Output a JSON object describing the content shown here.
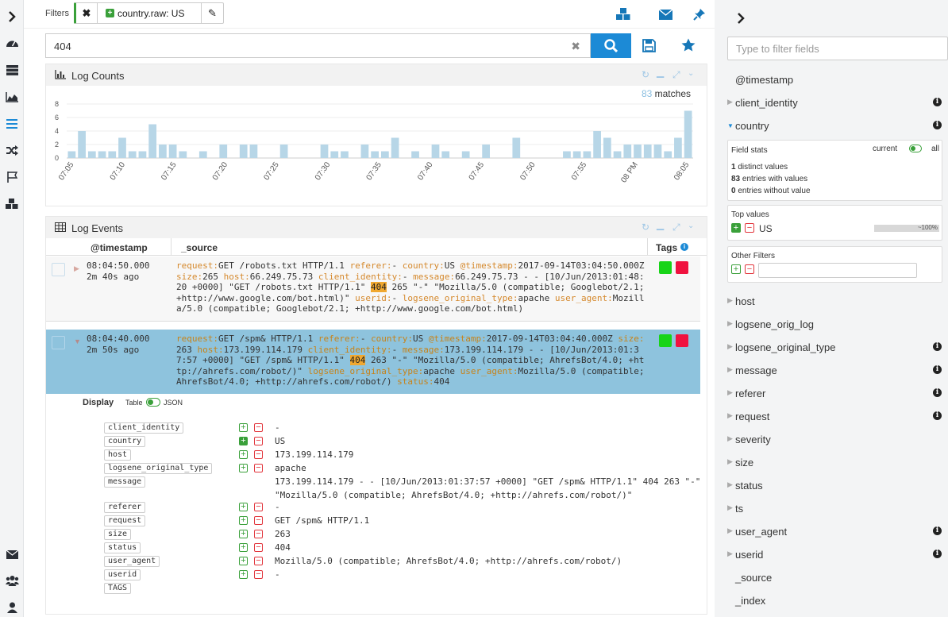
{
  "sidebar": {
    "icons": [
      "chevron-right-icon",
      "dashboard-icon",
      "server-icon",
      "area-chart-icon",
      "list-icon",
      "shuffle-icon",
      "flag-icon",
      "cubes-icon",
      "envelope-icon",
      "users-icon",
      "user-icon"
    ]
  },
  "filters": {
    "label": "Filters",
    "chip": "country.raw: US"
  },
  "search": {
    "query": "404"
  },
  "log_counts": {
    "title": "Log Counts",
    "match_count": "83",
    "match_label": "matches",
    "chart_data": {
      "type": "bar",
      "x_ticks": [
        "07:05",
        "07:10",
        "07:15",
        "07:20",
        "07:25",
        "07:30",
        "07:35",
        "07:40",
        "07:45",
        "07:50",
        "07:55",
        "08 PM",
        "08:05"
      ],
      "y_ticks": [
        "8",
        "6",
        "4",
        "2",
        "0"
      ],
      "ylim": [
        0,
        8
      ],
      "values": [
        1,
        4,
        1,
        1,
        1,
        3,
        1,
        1,
        5,
        2,
        2,
        1,
        0,
        1,
        0,
        2,
        0,
        2,
        2,
        0,
        0,
        2,
        0,
        0,
        0,
        2,
        1,
        1,
        0,
        2,
        1,
        1,
        3,
        0,
        1,
        0,
        2,
        1,
        0,
        1,
        0,
        2,
        0,
        0,
        3,
        0,
        0,
        0,
        0,
        1,
        1,
        1,
        4,
        3,
        1,
        2,
        2,
        2,
        2,
        1,
        3,
        7
      ]
    }
  },
  "log_events": {
    "title": "Log Events",
    "col_timestamp": "@timestamp",
    "col_source": "_source",
    "col_tags": "Tags",
    "rows": [
      {
        "time": "08:04:50.000",
        "ago": "2m 40s ago",
        "k_request": "request:",
        "v_request": "GET /robots.txt HTTP/1.1",
        "k_referer": "referer:",
        "v_referer": "-",
        "k_country": "country:",
        "v_country": "US",
        "k_ts": "@timestamp:",
        "v_ts": "2017-09-14T03:04:50.000Z",
        "k_size": "size:",
        "v_size": "265",
        "k_host": "host:",
        "v_host": "66.249.75.73",
        "k_client": "client_identity:",
        "v_client": "-",
        "k_message": "message:",
        "v_message_a": "66.249.75.73 - - [10/Jun/2013:01:48:20 +0000] \"GET /robots.txt HTTP/1.1\"",
        "v_message_hl": "404",
        "v_message_b": "265 \"-\" \"Mozilla/5.0 (compatible; Googlebot/2.1; +http://www.google.com/bot.html)\"",
        "k_userid": "userid:",
        "v_userid": "-",
        "k_lot": "logsene_original_type:",
        "v_lot": "apache",
        "k_ua": "user_agent:",
        "v_ua": "Mozilla/5.0 (compatible; Googlebot/2.1; +http://www.google.com/bot.html)"
      },
      {
        "time": "08:04:40.000",
        "ago": "2m 50s ago",
        "k_request": "request:",
        "v_request": "GET /spm& HTTP/1.1",
        "k_referer": "referer:",
        "v_referer": "-",
        "k_country": "country:",
        "v_country": "US",
        "k_ts": "@timestamp:",
        "v_ts": "2017-09-14T03:04:40.000Z",
        "k_size": "size:",
        "v_size": "263",
        "k_host": "host:",
        "v_host": "173.199.114.179",
        "k_client": "client_identity:",
        "v_client": "-",
        "k_message": "message:",
        "v_message_a": "173.199.114.179 - - [10/Jun/2013:01:37:57 +0000] \"GET /spm& HTTP/1.1\"",
        "v_message_hl": "404",
        "v_message_b": "263 \"-\" \"Mozilla/5.0 (compatible; AhrefsBot/4.0; +http://ahrefs.com/robot/)\"",
        "k_lot": "logsene_original_type:",
        "v_lot": "apache",
        "k_ua": "user_agent:",
        "v_ua": "Mozilla/5.0 (compatible; AhrefsBot/4.0; +http://ahrefs.com/robot/)",
        "k_status": "status:",
        "v_status": "404"
      }
    ],
    "detail": {
      "display_label": "Display",
      "table_label": "Table",
      "json_label": "JSON",
      "fields": [
        {
          "name": "client_identity",
          "value": "-"
        },
        {
          "name": "country",
          "value": "US"
        },
        {
          "name": "host",
          "value": "173.199.114.179"
        },
        {
          "name": "logsene_original_type",
          "value": "apache"
        },
        {
          "name": "message",
          "value": "173.199.114.179 - - [10/Jun/2013:01:37:57 +0000] \"GET /spm& HTTP/1.1\" 404 263 \"-\" \"Mozilla/5.0 (compatible; AhrefsBot/4.0; +http://ahrefs.com/robot/)\""
        },
        {
          "name": "referer",
          "value": "-"
        },
        {
          "name": "request",
          "value": "GET /spm& HTTP/1.1"
        },
        {
          "name": "size",
          "value": "263"
        },
        {
          "name": "status",
          "value": "404"
        },
        {
          "name": "user_agent",
          "value": "Mozilla/5.0 (compatible; AhrefsBot/4.0; +http://ahrefs.com/robot/)"
        },
        {
          "name": "userid",
          "value": "-"
        },
        {
          "name": "TAGS",
          "value": ""
        }
      ]
    }
  },
  "fields_panel": {
    "filter_placeholder": "Type to filter fields",
    "timestamp_field": "@timestamp",
    "fields_top": [
      {
        "name": "client_identity",
        "info": true
      },
      {
        "name": "country",
        "info": true,
        "expanded": true
      }
    ],
    "field_stats": {
      "title": "Field stats",
      "current": "current",
      "all": "all",
      "distinct_n": "1",
      "distinct_text": "distinct values",
      "with_n": "83",
      "with_text": "entries with values",
      "without_n": "0",
      "without_text": "entries without value"
    },
    "top_values": {
      "title": "Top values",
      "value": "US",
      "percent": "~100%",
      "fraction": 1.0
    },
    "other_filters": "Other Filters",
    "fields_bottom": [
      {
        "name": "host",
        "info": false
      },
      {
        "name": "logsene_orig_log",
        "info": false
      },
      {
        "name": "logsene_original_type",
        "info": true
      },
      {
        "name": "message",
        "info": true
      },
      {
        "name": "referer",
        "info": true
      },
      {
        "name": "request",
        "info": true
      },
      {
        "name": "severity",
        "info": false
      },
      {
        "name": "size",
        "info": false
      },
      {
        "name": "status",
        "info": false
      },
      {
        "name": "ts",
        "info": false
      },
      {
        "name": "user_agent",
        "info": true
      },
      {
        "name": "userid",
        "info": true
      }
    ],
    "meta_fields": [
      "_source",
      "_index"
    ]
  },
  "colors": {
    "accent": "#1c8ad6",
    "bar": "#b7d6e7",
    "selected_row": "#8ec3dd",
    "tag_green": "#18d418",
    "tag_red": "#f0123f",
    "highlight": "#f0a830"
  }
}
